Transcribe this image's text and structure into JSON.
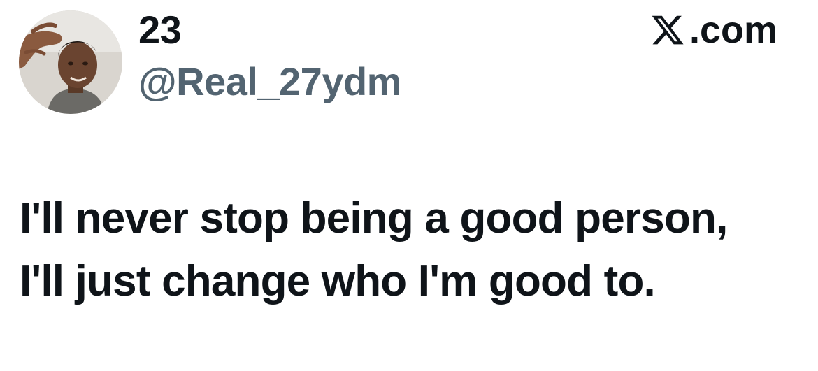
{
  "header": {
    "display_name": "23",
    "handle": "@Real_27ydm",
    "brand_icon": "x-logo-icon",
    "brand_suffix": ".com"
  },
  "tweet": {
    "lines": [
      "I'll never stop being a good person,",
      "I'll just change who I'm good to."
    ]
  },
  "colors": {
    "text_primary": "#0f1419",
    "text_secondary": "#536471",
    "background": "#ffffff"
  }
}
